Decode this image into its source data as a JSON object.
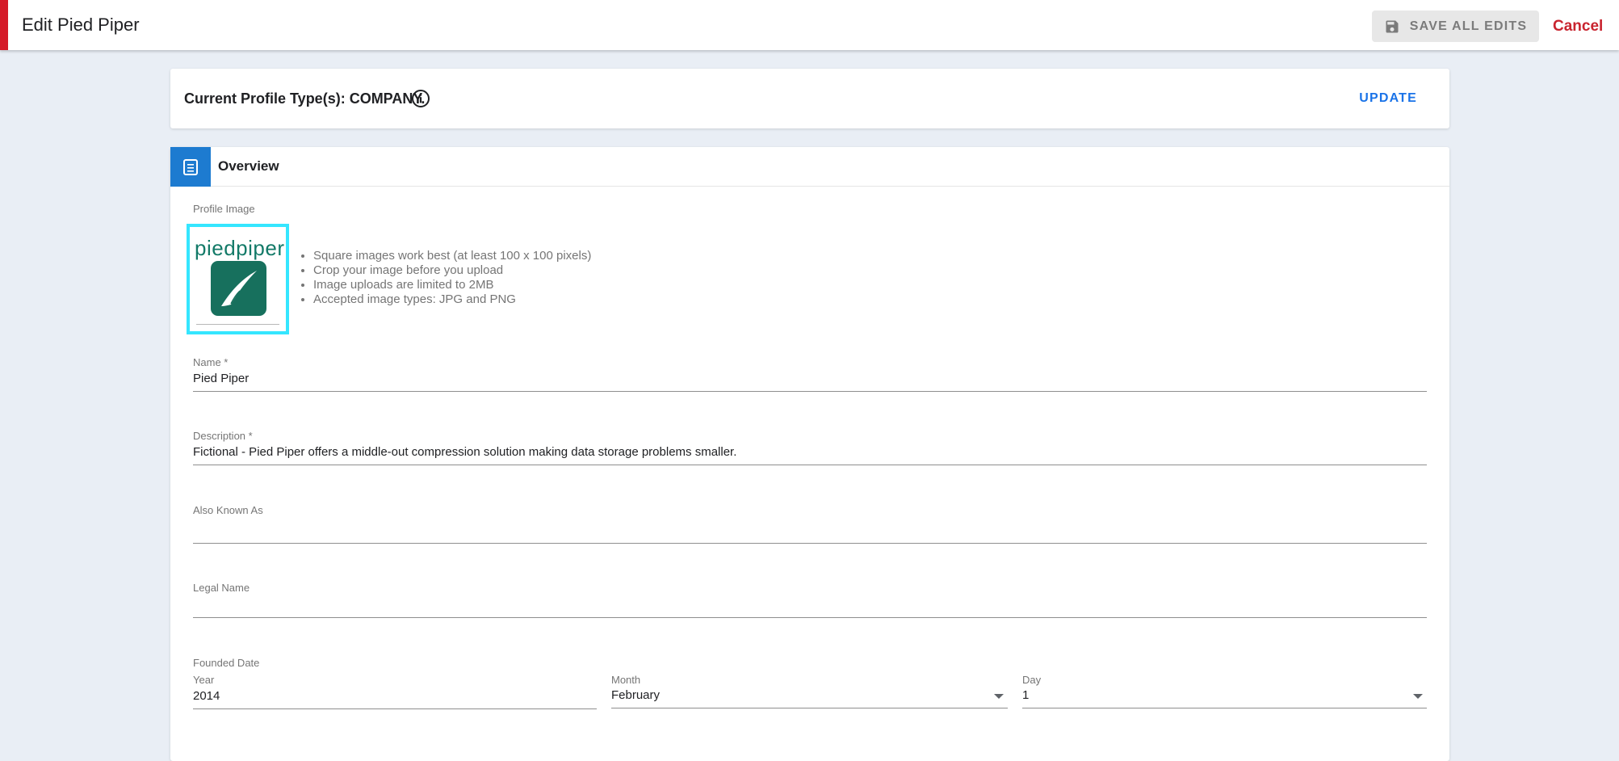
{
  "header": {
    "title": "Edit Pied Piper",
    "save_label": "SAVE ALL EDITS",
    "cancel_label": "Cancel",
    "accent_color": "#d51a28"
  },
  "profile_type": {
    "text": "Current Profile Type(s): COMPANY.",
    "update_label": "UPDATE",
    "info_icon": "info-icon"
  },
  "overview": {
    "title": "Overview",
    "icon": "document-icon",
    "profile_image": {
      "label": "Profile Image",
      "logo_text": "piedpiper",
      "tips": [
        "Square images work best (at least 100 x 100 pixels)",
        "Crop your image before you upload",
        "Image uploads are limited to 2MB",
        "Accepted image types: JPG and PNG"
      ]
    },
    "fields": {
      "name": {
        "label": "Name *",
        "value": "Pied Piper"
      },
      "description": {
        "label": "Description *",
        "value": "Fictional - Pied Piper offers a middle-out compression solution making data storage problems smaller."
      },
      "also_known_as": {
        "label": "Also Known As",
        "value": ""
      },
      "legal_name": {
        "label": "Legal Name",
        "value": ""
      }
    },
    "founded_date": {
      "label": "Founded Date",
      "year": {
        "label": "Year",
        "value": "2014"
      },
      "month": {
        "label": "Month",
        "value": "February"
      },
      "day": {
        "label": "Day",
        "value": "1"
      }
    }
  }
}
